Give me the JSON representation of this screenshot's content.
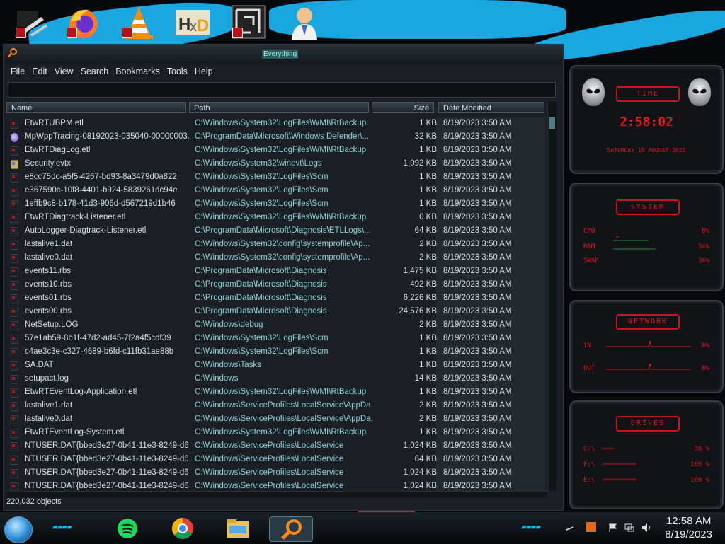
{
  "window": {
    "title": "Everything"
  },
  "menu": [
    "File",
    "Edit",
    "View",
    "Search",
    "Bookmarks",
    "Tools",
    "Help"
  ],
  "search": {
    "value": "",
    "placeholder": ""
  },
  "columns": {
    "name": "Name",
    "path": "Path",
    "size": "Size",
    "date": "Date Modified"
  },
  "rows": [
    {
      "name": "EtwRTUBPM.etl",
      "path": "C:\\Windows\\System32\\LogFiles\\WMI\\RtBackup",
      "size": "1 KB",
      "date": "8/19/2023 3:50 AM",
      "icon": "log"
    },
    {
      "name": "MpWppTracing-08192023-035040-00000003...",
      "path": "C:\\ProgramData\\Microsoft\\Windows Defender\\...",
      "size": "32 KB",
      "date": "8/19/2023 3:50 AM",
      "icon": "gem"
    },
    {
      "name": "EtwRTDiagLog.etl",
      "path": "C:\\Windows\\System32\\LogFiles\\WMI\\RtBackup",
      "size": "1 KB",
      "date": "8/19/2023 3:50 AM",
      "icon": "log"
    },
    {
      "name": "Security.evtx",
      "path": "C:\\Windows\\System32\\winevt\\Logs",
      "size": "1,092 KB",
      "date": "8/19/2023 3:50 AM",
      "icon": "doc"
    },
    {
      "name": "e8cc75dc-a5f5-4267-bd93-8a3479d0a822",
      "path": "C:\\Windows\\System32\\LogFiles\\Scm",
      "size": "1 KB",
      "date": "8/19/2023 3:50 AM",
      "icon": "log"
    },
    {
      "name": "e367590c-10f8-4401-b924-5839261dc94e",
      "path": "C:\\Windows\\System32\\LogFiles\\Scm",
      "size": "1 KB",
      "date": "8/19/2023 3:50 AM",
      "icon": "log"
    },
    {
      "name": "1effb9c8-b178-41d3-906d-d567219d1b46",
      "path": "C:\\Windows\\System32\\LogFiles\\Scm",
      "size": "1 KB",
      "date": "8/19/2023 3:50 AM",
      "icon": "log"
    },
    {
      "name": "EtwRTDiagtrack-Listener.etl",
      "path": "C:\\Windows\\System32\\LogFiles\\WMI\\RtBackup",
      "size": "0 KB",
      "date": "8/19/2023 3:50 AM",
      "icon": "log"
    },
    {
      "name": "AutoLogger-Diagtrack-Listener.etl",
      "path": "C:\\ProgramData\\Microsoft\\Diagnosis\\ETLLogs\\...",
      "size": "64 KB",
      "date": "8/19/2023 3:50 AM",
      "icon": "log"
    },
    {
      "name": "lastalive1.dat",
      "path": "C:\\Windows\\System32\\config\\systemprofile\\Ap...",
      "size": "2 KB",
      "date": "8/19/2023 3:50 AM",
      "icon": "log"
    },
    {
      "name": "lastalive0.dat",
      "path": "C:\\Windows\\System32\\config\\systemprofile\\Ap...",
      "size": "2 KB",
      "date": "8/19/2023 3:50 AM",
      "icon": "log"
    },
    {
      "name": "events11.rbs",
      "path": "C:\\ProgramData\\Microsoft\\Diagnosis",
      "size": "1,475 KB",
      "date": "8/19/2023 3:50 AM",
      "icon": "log"
    },
    {
      "name": "events10.rbs",
      "path": "C:\\ProgramData\\Microsoft\\Diagnosis",
      "size": "492 KB",
      "date": "8/19/2023 3:50 AM",
      "icon": "log"
    },
    {
      "name": "events01.rbs",
      "path": "C:\\ProgramData\\Microsoft\\Diagnosis",
      "size": "6,226 KB",
      "date": "8/19/2023 3:50 AM",
      "icon": "log"
    },
    {
      "name": "events00.rbs",
      "path": "C:\\ProgramData\\Microsoft\\Diagnosis",
      "size": "24,576 KB",
      "date": "8/19/2023 3:50 AM",
      "icon": "log"
    },
    {
      "name": "NetSetup.LOG",
      "path": "C:\\Windows\\debug",
      "size": "2 KB",
      "date": "8/19/2023 3:50 AM",
      "icon": "log"
    },
    {
      "name": "57e1ab59-8b1f-47d2-ad45-7f2a4f5cdf39",
      "path": "C:\\Windows\\System32\\LogFiles\\Scm",
      "size": "1 KB",
      "date": "8/19/2023 3:50 AM",
      "icon": "log"
    },
    {
      "name": "c4ae3c3e-c327-4689-b6fd-c11fb31ae88b",
      "path": "C:\\Windows\\System32\\LogFiles\\Scm",
      "size": "1 KB",
      "date": "8/19/2023 3:50 AM",
      "icon": "log"
    },
    {
      "name": "SA.DAT",
      "path": "C:\\Windows\\Tasks",
      "size": "1 KB",
      "date": "8/19/2023 3:50 AM",
      "icon": "log"
    },
    {
      "name": "setupact.log",
      "path": "C:\\Windows",
      "size": "14 KB",
      "date": "8/19/2023 3:50 AM",
      "icon": "log"
    },
    {
      "name": "EtwRTEventLog-Application.etl",
      "path": "C:\\Windows\\System32\\LogFiles\\WMI\\RtBackup",
      "size": "1 KB",
      "date": "8/19/2023 3:50 AM",
      "icon": "log"
    },
    {
      "name": "lastalive1.dat",
      "path": "C:\\Windows\\ServiceProfiles\\LocalService\\AppDa...",
      "size": "2 KB",
      "date": "8/19/2023 3:50 AM",
      "icon": "log"
    },
    {
      "name": "lastalive0.dat",
      "path": "C:\\Windows\\ServiceProfiles\\LocalService\\AppDa...",
      "size": "2 KB",
      "date": "8/19/2023 3:50 AM",
      "icon": "log"
    },
    {
      "name": "EtwRTEventLog-System.etl",
      "path": "C:\\Windows\\System32\\LogFiles\\WMI\\RtBackup",
      "size": "1 KB",
      "date": "8/19/2023 3:50 AM",
      "icon": "log"
    },
    {
      "name": "NTUSER.DAT{bbed3e27-0b41-11e3-8249-d6...",
      "path": "C:\\Windows\\ServiceProfiles\\LocalService",
      "size": "1,024 KB",
      "date": "8/19/2023 3:50 AM",
      "icon": "log"
    },
    {
      "name": "NTUSER.DAT{bbed3e27-0b41-11e3-8249-d6...",
      "path": "C:\\Windows\\ServiceProfiles\\LocalService",
      "size": "64 KB",
      "date": "8/19/2023 3:50 AM",
      "icon": "log"
    },
    {
      "name": "NTUSER.DAT{bbed3e27-0b41-11e3-8249-d6...",
      "path": "C:\\Windows\\ServiceProfiles\\LocalService",
      "size": "1,024 KB",
      "date": "8/19/2023 3:50 AM",
      "icon": "log"
    },
    {
      "name": "NTUSER.DAT{bbed3e27-0b41-11e3-8249-d6...",
      "path": "C:\\Windows\\ServiceProfiles\\LocalService",
      "size": "1,024 KB",
      "date": "8/19/2023 3:50 AM",
      "icon": "log"
    }
  ],
  "status": {
    "count": "220,032 objects"
  },
  "gadgets": {
    "time": {
      "header": "TIME",
      "clock": "2:58:02",
      "date": "SATURDAY 19 AUGUST 2023"
    },
    "system": {
      "header": "SYSTEM",
      "rows": [
        {
          "label": "CPU",
          "value": "8%"
        },
        {
          "label": "RAM",
          "value": "34%"
        },
        {
          "label": "SWAP",
          "value": "36%"
        }
      ]
    },
    "network": {
      "header": "NETWORK",
      "rows": [
        {
          "label": "IN",
          "value": "0%"
        },
        {
          "label": "OUT",
          "value": "0%"
        }
      ]
    },
    "drives": {
      "header": "DRIVES",
      "rows": [
        {
          "label": "C:\\",
          "value": "38 %"
        },
        {
          "label": "F:\\",
          "value": "100 %"
        },
        {
          "label": "E:\\",
          "value": "100 %"
        }
      ]
    }
  },
  "taskbar": {
    "time": "12:58 AM",
    "date": "8/19/2023"
  },
  "desktop_icons": [
    "tools-icon",
    "firefox-icon",
    "vlc-icon",
    "hxd-icon",
    "maze-icon",
    "doctor-icon"
  ],
  "colors": {
    "accent_red": "#e0171c",
    "accent_cyan": "#1aa7e0",
    "path_text": "#8ad2d8"
  }
}
